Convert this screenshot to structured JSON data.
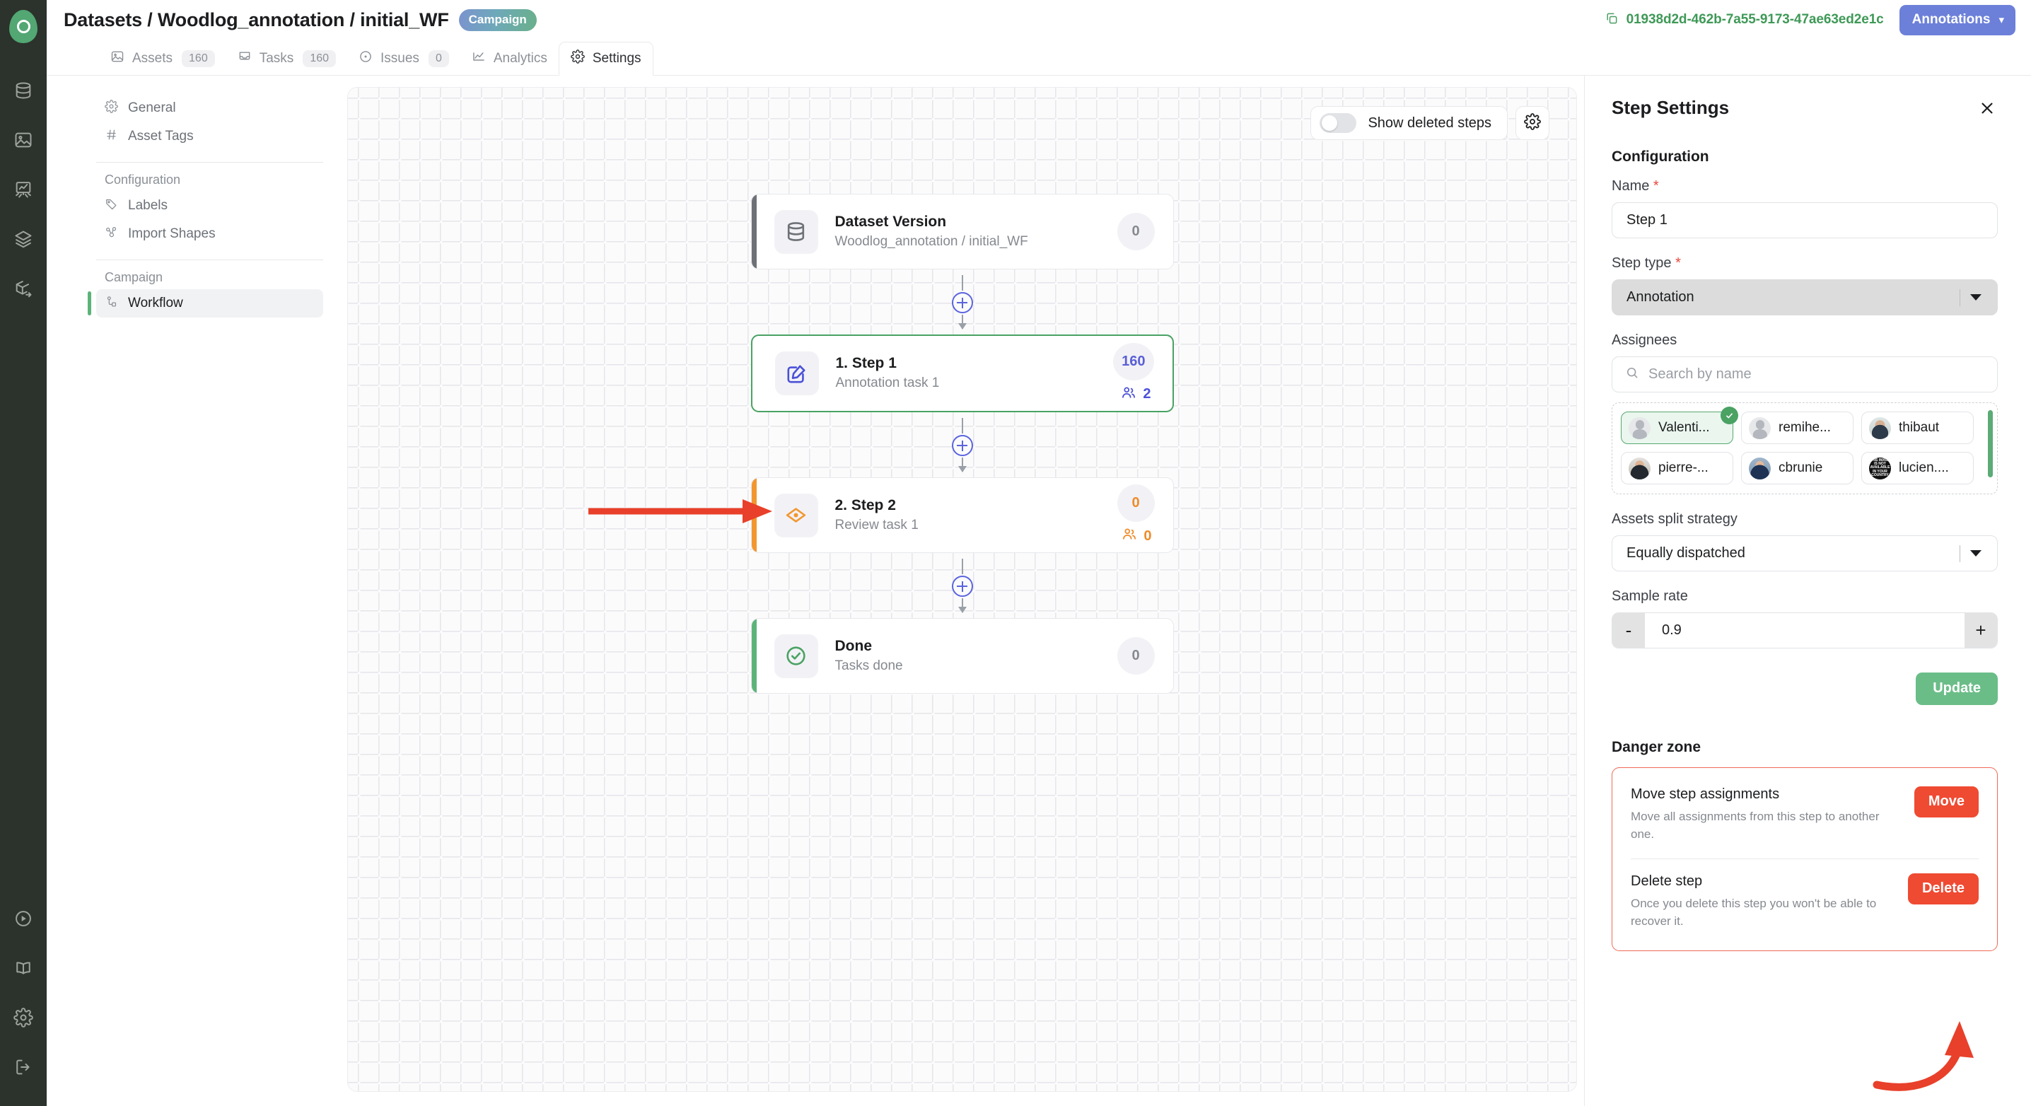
{
  "brand": {
    "logo_name": "kili-logo",
    "accent_green": "#4aa263",
    "accent_blue": "#6c80d9",
    "danger_red": "#ef4a32"
  },
  "topbar": {
    "breadcrumb": "Datasets / Woodlog_annotation / initial_WF",
    "badge": "Campaign",
    "uuid": "01938d2d-462b-7a55-9173-47ae63ed2e1c",
    "annotations_button": "Annotations",
    "chevron": "⌄"
  },
  "tabs": [
    {
      "label": "Assets",
      "count": "160",
      "icon": "image-icon",
      "active": false
    },
    {
      "label": "Tasks",
      "count": "160",
      "icon": "inbox-icon",
      "active": false
    },
    {
      "label": "Issues",
      "count": "0",
      "icon": "issue-icon",
      "active": false
    },
    {
      "label": "Analytics",
      "count": "",
      "icon": "analytics-icon",
      "active": false
    },
    {
      "label": "Settings",
      "count": "",
      "icon": "gear-icon",
      "active": true
    }
  ],
  "settings_nav": {
    "top_items": [
      {
        "label": "General",
        "icon": "gear-icon"
      },
      {
        "label": "Asset Tags",
        "icon": "hash-icon"
      }
    ],
    "group_configuration": "Configuration",
    "configuration_items": [
      {
        "label": "Labels",
        "icon": "tag-icon"
      },
      {
        "label": "Import Shapes",
        "icon": "shapes-icon"
      }
    ],
    "group_campaign": "Campaign",
    "campaign_items": [
      {
        "label": "Workflow",
        "icon": "workflow-icon",
        "active": true
      }
    ]
  },
  "canvas": {
    "toggle_label": "Show deleted steps",
    "toggle_on": false,
    "gear_icon": "gear-icon",
    "nodes": [
      {
        "title": "Dataset Version",
        "subtitle": "Woodlog_annotation / initial_WF",
        "count": "0",
        "assignees": null,
        "icon": "database-icon",
        "accent": "#6e7278",
        "selected": false,
        "count_color": "grey"
      },
      {
        "title": "1. Step 1",
        "subtitle": "Annotation task 1",
        "count": "160",
        "assignees": "2",
        "icon": "annotate-icon",
        "accent": "#4aa263",
        "selected": true,
        "count_color": "blue"
      },
      {
        "title": "2. Step 2",
        "subtitle": "Review task 1",
        "count": "0",
        "assignees": "0",
        "icon": "review-eye-icon",
        "accent": "#f2972f",
        "selected": false,
        "count_color": "orange"
      },
      {
        "title": "Done",
        "subtitle": "Tasks done",
        "count": "0",
        "assignees": null,
        "icon": "check-circle-icon",
        "accent": "#5cb37a",
        "selected": false,
        "count_color": "grey"
      }
    ]
  },
  "panel": {
    "title": "Step Settings",
    "close_icon": "close-icon",
    "configuration_heading": "Configuration",
    "name_label": "Name",
    "name_value": "Step 1",
    "step_type_label": "Step type",
    "step_type_value": "Annotation",
    "assignees_label": "Assignees",
    "assignees_search_placeholder": "Search by name",
    "assignees": [
      {
        "name": "Valenti...",
        "avatar": "silhouette",
        "selected": true
      },
      {
        "name": "remihe...",
        "avatar": "silhouette",
        "selected": false
      },
      {
        "name": "thibaut",
        "avatar": "photo1",
        "selected": false
      },
      {
        "name": "pierre-...",
        "avatar": "photo2",
        "selected": false
      },
      {
        "name": "cbrunie",
        "avatar": "photo3",
        "selected": false
      },
      {
        "name": "lucien....",
        "avatar": "black",
        "selected": false
      }
    ],
    "avatar_black_text": "THIS IMAGE IS NOT AVAILABLE IN YOUR COUNTRY",
    "split_strategy_label": "Assets split strategy",
    "split_strategy_value": "Equally dispatched",
    "sample_rate_label": "Sample rate",
    "sample_rate_value": "0.9",
    "stepper_minus": "-",
    "stepper_plus": "+",
    "update_button": "Update",
    "danger_heading": "Danger zone",
    "danger_items": [
      {
        "title": "Move step assignments",
        "description": "Move all assignments from this step to another one.",
        "button": "Move"
      },
      {
        "title": "Delete step",
        "description": "Once you delete this step you won't be able to recover it.",
        "button": "Delete"
      }
    ]
  },
  "annotations": {
    "arrow_left_name": "red-arrow-pointing-to-step-2",
    "arrow_right_name": "red-curved-arrow-pointing-to-delete-button",
    "color": "#e8402a"
  }
}
